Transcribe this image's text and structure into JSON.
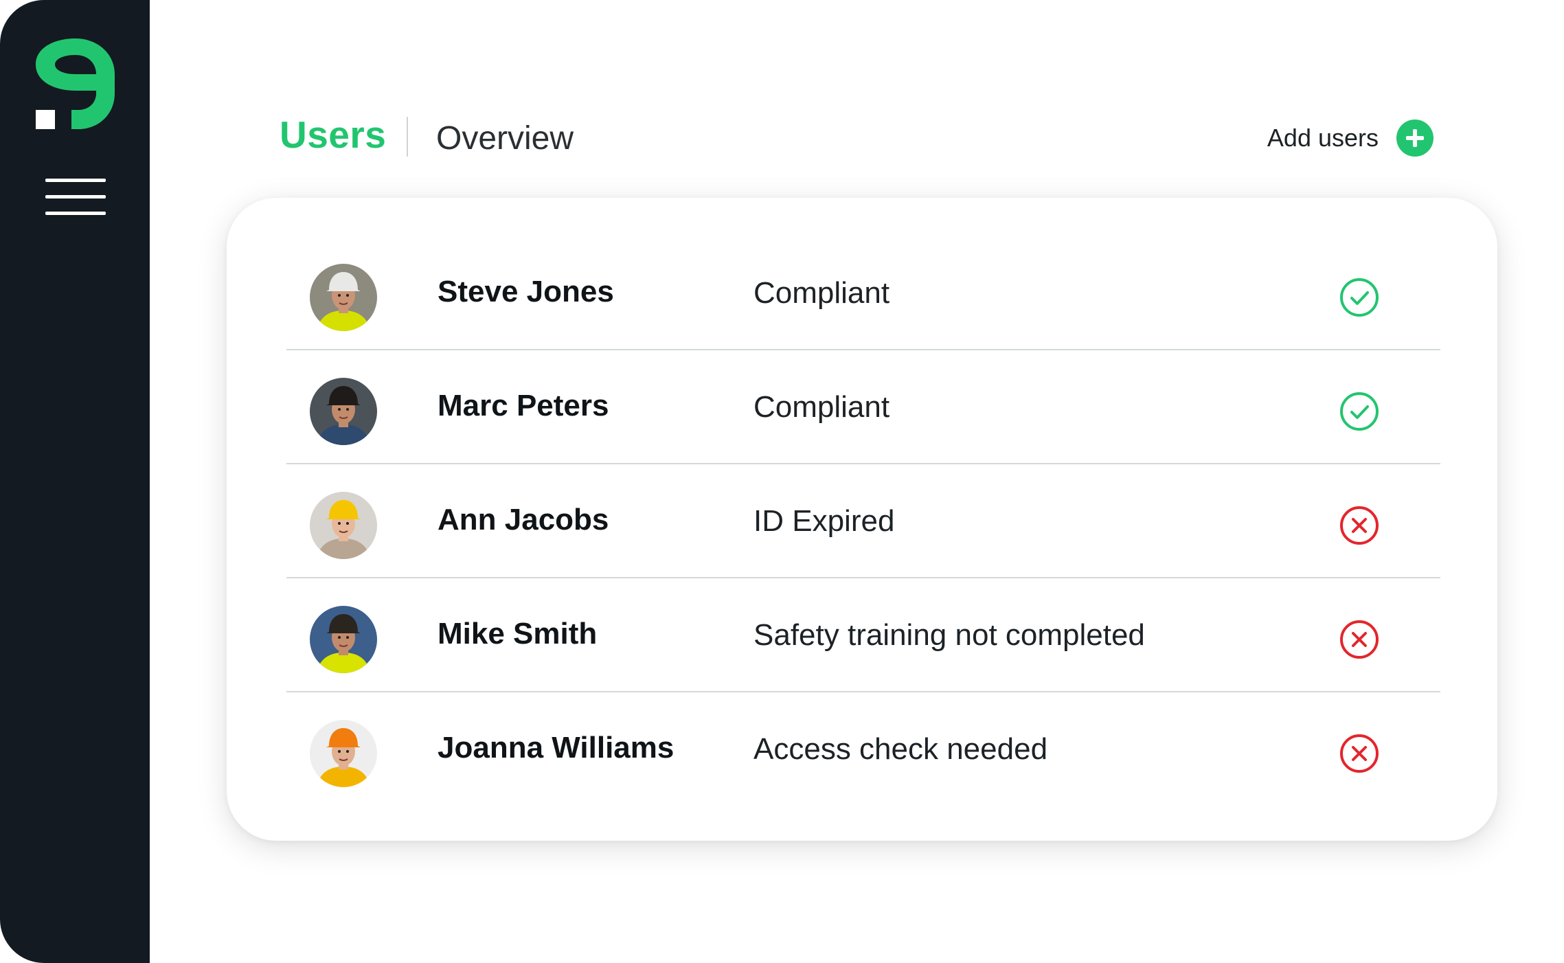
{
  "header": {
    "tab_active": "Users",
    "tab_inactive": "Overview",
    "add_users_label": "Add users"
  },
  "colors": {
    "sidebar": "#131a21",
    "accent_green": "#22c56f",
    "error_red": "#e3262c"
  },
  "users": [
    {
      "name": "Steve Jones",
      "status": "Compliant",
      "status_icon": "check-circle-icon",
      "avatar": {
        "helmet": "#e8e8e6",
        "skin": "#c99576",
        "shirt": "#d6e000",
        "bg": "#8d8a7e"
      }
    },
    {
      "name": "Marc Peters",
      "status": "Compliant",
      "status_icon": "check-circle-icon",
      "avatar": {
        "helmet": "#1f1b19",
        "skin": "#c28c6c",
        "shirt": "#2f4a6f",
        "bg": "#4b5258"
      }
    },
    {
      "name": "Ann Jacobs",
      "status": "ID Expired",
      "status_icon": "x-circle-icon",
      "avatar": {
        "helmet": "#f4c500",
        "skin": "#e7b99a",
        "shirt": "#b8a693",
        "bg": "#d7d3ce"
      }
    },
    {
      "name": "Mike Smith",
      "status": "Safety training not completed",
      "status_icon": "x-circle-icon",
      "avatar": {
        "helmet": "#2b2520",
        "skin": "#c28c6c",
        "shirt": "#d8e400",
        "bg": "#3d5f8b"
      }
    },
    {
      "name": "Joanna Williams",
      "status": "Access check needed",
      "status_icon": "x-circle-icon",
      "avatar": {
        "helmet": "#f07d0e",
        "skin": "#e0b090",
        "shirt": "#f3b400",
        "bg": "#eeeeee"
      }
    }
  ]
}
